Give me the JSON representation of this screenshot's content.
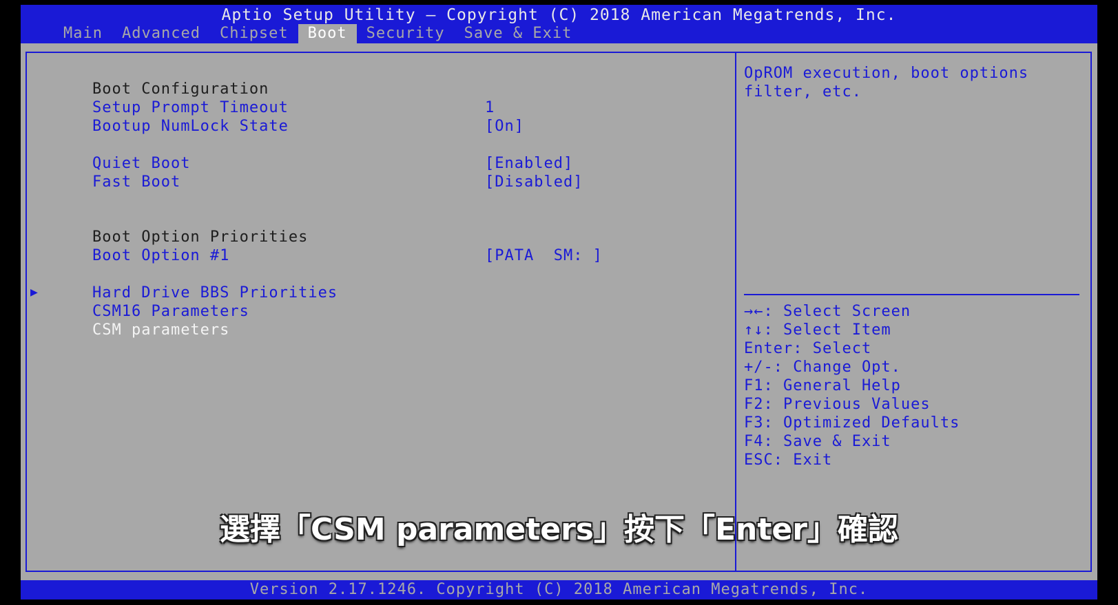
{
  "title": "Aptio Setup Utility – Copyright (C) 2018 American Megatrends, Inc.",
  "tabs": [
    {
      "label": "Main"
    },
    {
      "label": "Advanced"
    },
    {
      "label": "Chipset"
    },
    {
      "label": "Boot"
    },
    {
      "label": "Security"
    },
    {
      "label": "Save & Exit"
    }
  ],
  "active_tab": "Boot",
  "menu": {
    "boot_configuration": "Boot Configuration",
    "setup_prompt_timeout": {
      "label": "Setup Prompt Timeout",
      "value": "1"
    },
    "bootup_numlock_state": {
      "label": "Bootup NumLock State",
      "value": "[On]"
    },
    "quiet_boot": {
      "label": "Quiet Boot",
      "value": "[Enabled]"
    },
    "fast_boot": {
      "label": "Fast Boot",
      "value": "[Disabled]"
    },
    "boot_option_priorities": "Boot Option Priorities",
    "boot_option_1": {
      "label": "Boot Option #1",
      "value": "[PATA  SM: ]"
    },
    "hard_drive_bbs": "Hard Drive BBS Priorities",
    "csm16_parameters": "CSM16 Parameters",
    "csm_parameters": "CSM parameters"
  },
  "help": {
    "description": "OpROM execution, boot options filter, etc.",
    "keys": [
      "→←: Select Screen",
      "↑↓: Select Item",
      "Enter: Select",
      "+/-: Change Opt.",
      "F1: General Help",
      "F2: Previous Values",
      "F3: Optimized Defaults",
      "F4: Save & Exit",
      "ESC: Exit"
    ]
  },
  "subtitle": "選擇「CSM parameters」按下「Enter」確認",
  "footer": "Version 2.17.1246. Copyright (C) 2018 American Megatrends, Inc.",
  "colors": {
    "bios_blue": "#1a1ad6",
    "bios_gray": "#a8a8a8",
    "highlight": "#f4f4f4"
  },
  "icons": {
    "submenu": "triangle-right-icon"
  }
}
